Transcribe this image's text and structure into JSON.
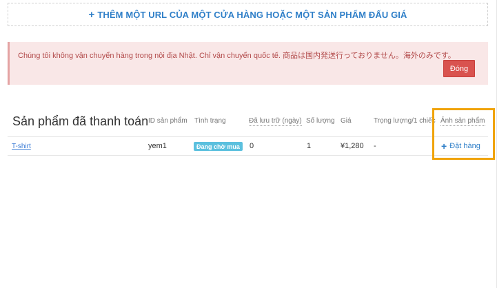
{
  "add_url": {
    "label": "THÊM MỘT URL CỦA MỘT CỬA HÀNG HOẶC MỘT SẢN PHẨM ĐẤU GIÁ",
    "icon": "plus-icon"
  },
  "alert": {
    "message": "Chúng tôi không vận chuyển hàng trong nội địa Nhật. Chỉ vận chuyển quốc tế. 商品は国内発送行っておりません。海外のみです。",
    "close_label": "Đóng"
  },
  "section": {
    "title": "Sản phẩm đã thanh toán"
  },
  "table": {
    "headers": {
      "id": "ID sản phẩm",
      "status": "Tình trạng",
      "stored_days": "Đã lưu trữ (ngày)",
      "quantity": "Số lượng",
      "price": "Giá",
      "weight": "Trọng lượng/1 chiếc",
      "image": "Ảnh sản phẩm"
    },
    "rows": [
      {
        "name": "T-shirt",
        "id": "yem1",
        "status": "Đang chờ mua",
        "stored_days": "0",
        "quantity": "1",
        "price": "¥1,280",
        "weight": "-",
        "action": "Đặt hàng"
      }
    ]
  },
  "colors": {
    "accent": "#2f7fc8",
    "danger": "#d9534f",
    "info": "#5bc0de",
    "highlight": "#f0a30a"
  }
}
